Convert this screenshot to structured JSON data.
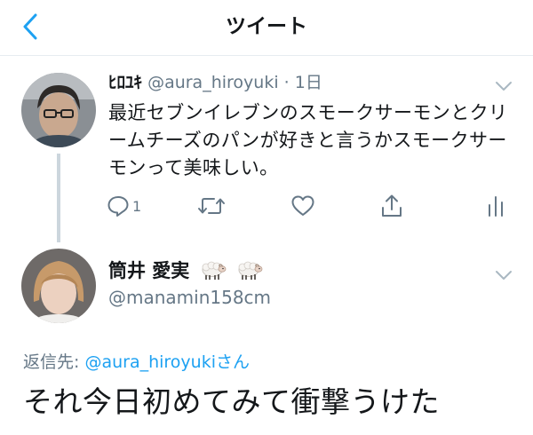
{
  "nav": {
    "title": "ツイート",
    "back_icon": "chevron-left-icon"
  },
  "parent_tweet": {
    "display_name": "ﾋﾛﾕｷ",
    "handle_time": "@aura_hiroyuki · 1日",
    "text": "最近セブンイレブンのスモークサーモンとクリームチーズのパンが好きと言うかスモークサーモンって美味しい。",
    "reply_count": "1",
    "menu_icon": "chevron-down-icon"
  },
  "reply_tweet": {
    "display_name": "筒井 愛実",
    "name_emoji": [
      "sheep-icon",
      "sheep-icon"
    ],
    "handle": "@manamin158cm",
    "replying_label": "返信先: ",
    "replying_to": "@aura_hiroyuki",
    "replying_suffix": "さん",
    "text": "それ今日初めてみて衝撃うけた",
    "menu_icon": "chevron-down-icon"
  },
  "colors": {
    "accent": "#1da1f2",
    "secondary_text": "#657786",
    "thread_line": "#ccd6dd"
  }
}
